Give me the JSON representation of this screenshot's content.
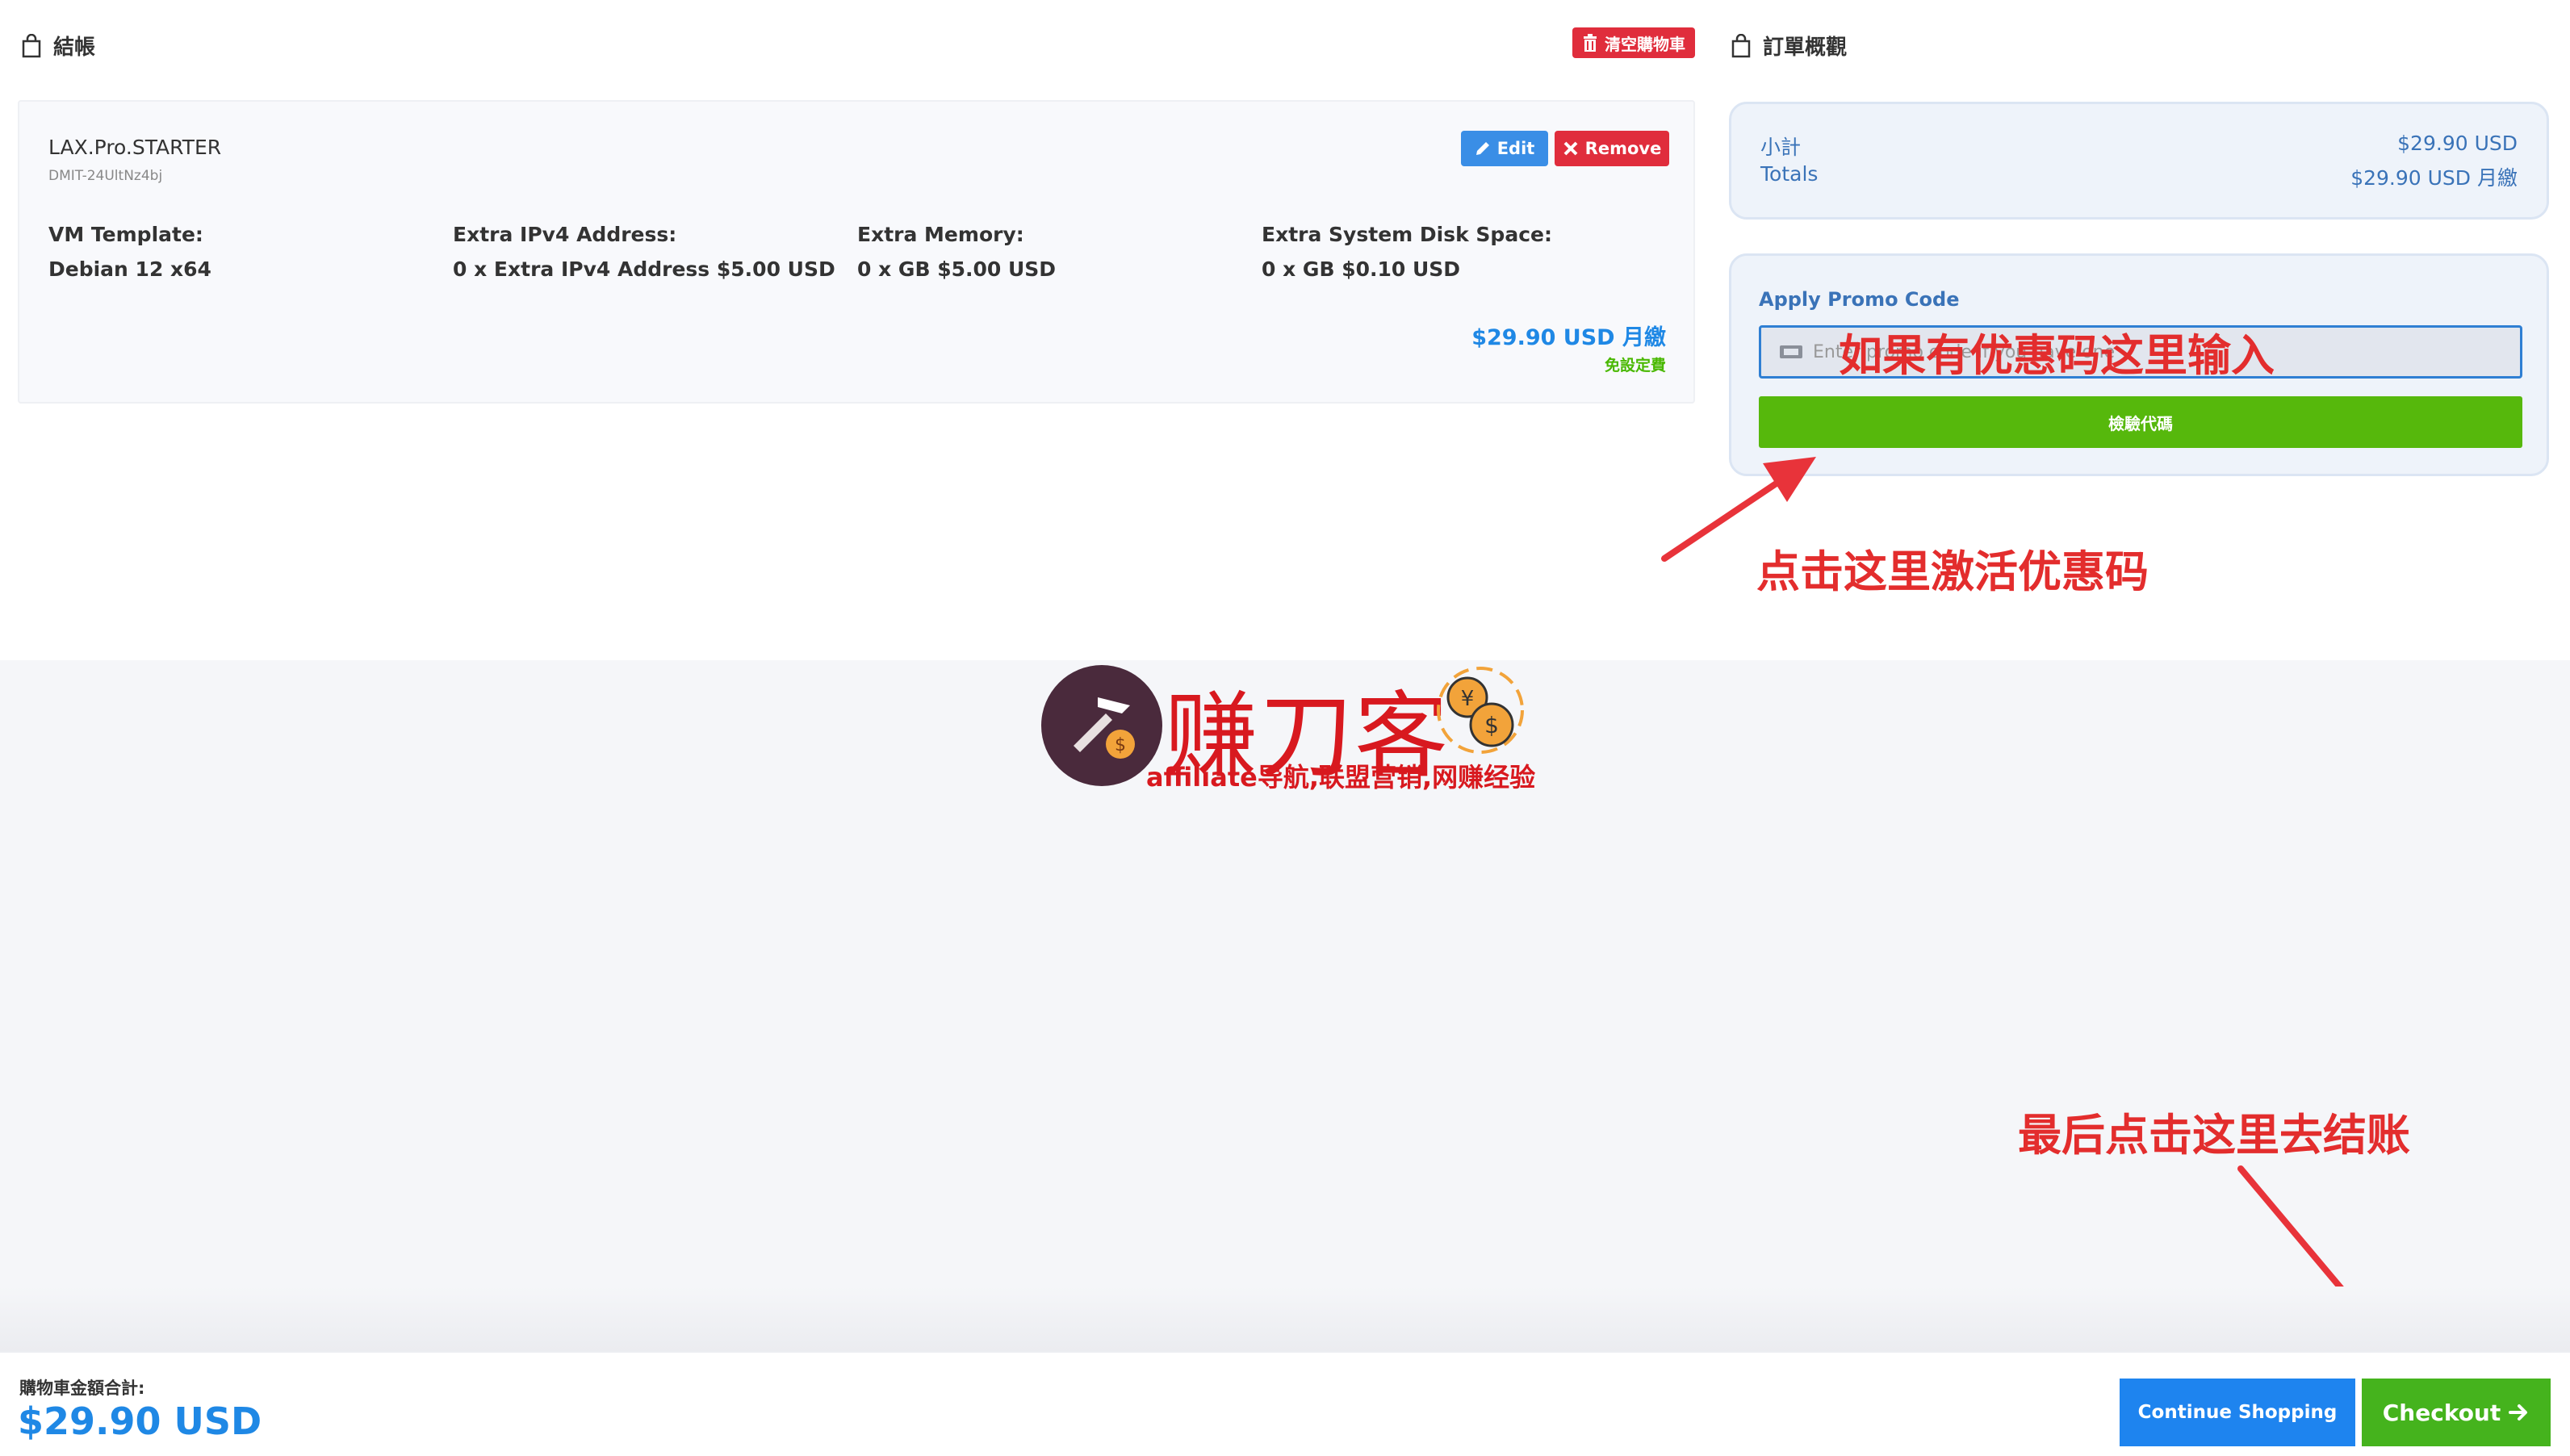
{
  "checkout": {
    "title": "結帳",
    "clear_cart_label": "清空購物車"
  },
  "product": {
    "name": "LAX.Pro.STARTER",
    "code": "DMIT-24UltNz4bj",
    "edit_label": "Edit",
    "remove_label": "Remove",
    "configs": [
      {
        "label": "VM Template:",
        "value": "Debian 12 x64"
      },
      {
        "label": "Extra IPv4 Address:",
        "value": "0 x Extra IPv4 Address $5.00 USD"
      },
      {
        "label": "Extra Memory:",
        "value": "0 x GB $5.00 USD"
      },
      {
        "label": "Extra System Disk Space:",
        "value": "0 x GB $0.10 USD"
      }
    ],
    "price": "$29.90 USD 月繳",
    "setup_fee": "免設定費"
  },
  "order_summary": {
    "title": "訂單概觀",
    "subtotal_label": "小計",
    "subtotal_value": "$29.90 USD",
    "totals_label": "Totals",
    "totals_value": "$29.90 USD 月繳"
  },
  "promo": {
    "label": "Apply Promo Code",
    "placeholder": "Enter promo code if you have one",
    "validate_label": "檢驗代碼"
  },
  "annotations": {
    "promo_hint": "如果有优惠码这里输入",
    "activate_hint": "点击这里激活优惠码",
    "checkout_hint": "最后点击这里去结账"
  },
  "watermark": {
    "title": "赚刀客",
    "subtitle": "affiliate导航,联盟营销,网赚经验"
  },
  "footer": {
    "total_label": "購物車金額合計:",
    "total_amount": "$29.90 USD",
    "continue_label": "Continue Shopping",
    "checkout_label": "Checkout"
  },
  "colors": {
    "primary_blue": "#1f88e5",
    "danger_red": "#e02d3c",
    "success_green": "#45b31d",
    "annotation_red": "#e32d2d"
  },
  "icons": [
    "shopping-bag-icon",
    "trash-icon",
    "pencil-icon",
    "close-icon",
    "ticket-icon",
    "arrow-right-icon"
  ]
}
